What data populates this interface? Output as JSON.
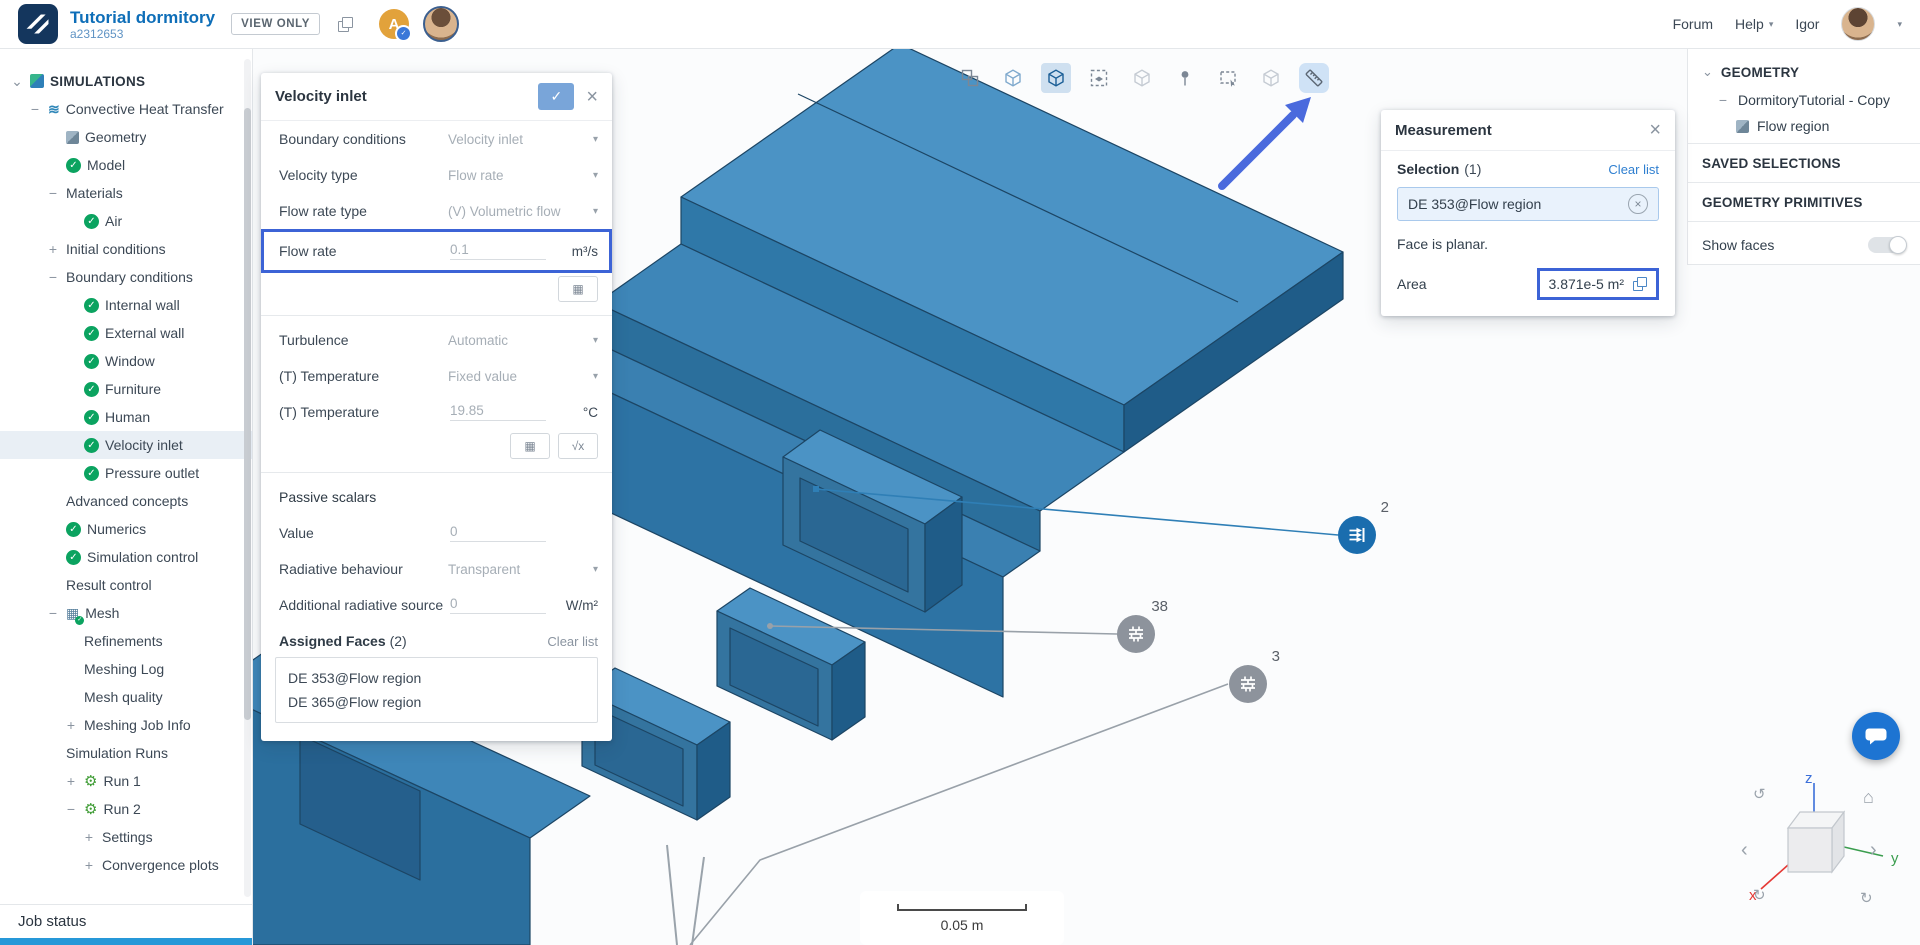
{
  "header": {
    "title": "Tutorial dormitory",
    "project_id": "a2312653",
    "view_only_badge": "VIEW ONLY",
    "owner_initial": "A",
    "nav": {
      "forum": "Forum",
      "help": "Help",
      "user": "Igor"
    }
  },
  "sidebar": {
    "items": [
      {
        "label": "SIMULATIONS",
        "indent": 0,
        "expander": "chevron",
        "icon": "simulations"
      },
      {
        "label": "Convective Heat Transfer",
        "indent": 1,
        "expander": "minus",
        "icon": "heat"
      },
      {
        "label": "Geometry",
        "indent": 2,
        "icon": "geometry"
      },
      {
        "label": "Model",
        "indent": 2,
        "icon": "check"
      },
      {
        "label": "Materials",
        "indent": 2,
        "expander": "minus"
      },
      {
        "label": "Air",
        "indent": 3,
        "icon": "check"
      },
      {
        "label": "Initial conditions",
        "indent": 2,
        "expander": "plus"
      },
      {
        "label": "Boundary conditions",
        "indent": 2,
        "expander": "minus"
      },
      {
        "label": "Internal wall",
        "indent": 3,
        "icon": "check"
      },
      {
        "label": "External wall",
        "indent": 3,
        "icon": "check"
      },
      {
        "label": "Window",
        "indent": 3,
        "icon": "check"
      },
      {
        "label": "Furniture",
        "indent": 3,
        "icon": "check"
      },
      {
        "label": "Human",
        "indent": 3,
        "icon": "check"
      },
      {
        "label": "Velocity inlet",
        "indent": 3,
        "icon": "check",
        "selected": true
      },
      {
        "label": "Pressure outlet",
        "indent": 3,
        "icon": "check"
      },
      {
        "label": "Advanced concepts",
        "indent": 2
      },
      {
        "label": "Numerics",
        "indent": 2,
        "icon": "check"
      },
      {
        "label": "Simulation control",
        "indent": 2,
        "icon": "check"
      },
      {
        "label": "Result control",
        "indent": 2
      },
      {
        "label": "Mesh",
        "indent": 2,
        "expander": "minus",
        "icon": "mesh"
      },
      {
        "label": "Refinements",
        "indent": 3
      },
      {
        "label": "Meshing Log",
        "indent": 3
      },
      {
        "label": "Mesh quality",
        "indent": 3
      },
      {
        "label": "Meshing Job Info",
        "indent": 3,
        "expander": "plus"
      },
      {
        "label": "Simulation Runs",
        "indent": 2
      },
      {
        "label": "Run 1",
        "indent": 3,
        "expander": "plus",
        "icon": "gear"
      },
      {
        "label": "Run 2",
        "indent": 3,
        "expander": "minus",
        "icon": "gear"
      },
      {
        "label": "Settings",
        "indent": 4,
        "expander": "plus"
      },
      {
        "label": "Convergence plots",
        "indent": 4,
        "expander": "plus"
      }
    ],
    "job_status": "Job status"
  },
  "inlet_panel": {
    "title": "Velocity inlet",
    "rows": [
      {
        "t": "select",
        "label": "Boundary conditions",
        "value": "Velocity inlet"
      },
      {
        "t": "select",
        "label": "Velocity type",
        "value": "Flow rate"
      },
      {
        "t": "select",
        "label": "Flow rate type",
        "value": "(V) Volumetric flow"
      },
      {
        "t": "input",
        "label": "Flow rate",
        "value": "0.1",
        "unit": "m³/s",
        "highlight": true
      },
      {
        "t": "buttons",
        "icons": [
          "table"
        ]
      },
      {
        "t": "divider"
      },
      {
        "t": "select",
        "label": "Turbulence",
        "value": "Automatic"
      },
      {
        "t": "select",
        "label": "(T) Temperature",
        "value": "Fixed value"
      },
      {
        "t": "input",
        "label": "(T) Temperature",
        "value": "19.85",
        "unit": "°C"
      },
      {
        "t": "buttons",
        "icons": [
          "table",
          "formula"
        ]
      },
      {
        "t": "divider"
      },
      {
        "t": "section",
        "label": "Passive scalars"
      },
      {
        "t": "input",
        "label": "Value",
        "value": "0",
        "unit": ""
      },
      {
        "t": "select",
        "label": "Radiative behaviour",
        "value": "Transparent"
      },
      {
        "t": "input",
        "label": "Additional radiative source",
        "value": "0",
        "unit": "W/m²"
      }
    ],
    "assigned": {
      "label": "Assigned Faces",
      "count": "(2)",
      "clear": "Clear list",
      "items": [
        "DE 353@Flow region",
        "DE 365@Flow region"
      ]
    }
  },
  "toolbar": {
    "icons": [
      {
        "name": "select-group-icon",
        "state": "normal",
        "glyph": "layers"
      },
      {
        "name": "view-solid-icon",
        "state": "tinted",
        "glyph": "cube"
      },
      {
        "name": "select-volume-icon",
        "state": "active",
        "glyph": "cube"
      },
      {
        "name": "select-face-icon",
        "state": "normal",
        "glyph": "face"
      },
      {
        "name": "select-edge-icon",
        "state": "disabled",
        "glyph": "cube"
      },
      {
        "name": "probe-point-icon",
        "state": "normal",
        "glyph": "pin"
      },
      {
        "name": "box-select-icon",
        "state": "normal",
        "glyph": "marquee"
      },
      {
        "name": "select-hidden-icon",
        "state": "disabled",
        "glyph": "cube"
      },
      {
        "name": "measure-tool-icon",
        "state": "highlight",
        "glyph": "measure"
      }
    ]
  },
  "measurement": {
    "title": "Measurement",
    "selection_label": "Selection",
    "selection_count": "(1)",
    "clear": "Clear list",
    "chip": "DE 353@Flow region",
    "note": "Face is planar.",
    "area_label": "Area",
    "area_value": "3.871e-5 m²"
  },
  "geometry_panel": {
    "geometry_header": "GEOMETRY",
    "tree_root": "DormitoryTutorial - Copy",
    "tree_child": "Flow region",
    "saved_selections": "SAVED SELECTIONS",
    "geometry_primitives": "GEOMETRY PRIMITIVES",
    "show_faces": "Show faces"
  },
  "viewport": {
    "markers": [
      {
        "label": "2",
        "type": "inlet"
      },
      {
        "label": "38",
        "type": "wall"
      },
      {
        "label": "3",
        "type": "wall"
      }
    ],
    "scale_label": "0.05 m"
  },
  "nav_cube": {
    "x": "x",
    "y": "y",
    "z": "z"
  },
  "colors": {
    "accent": "#3c63d6",
    "check_green": "#0ba360",
    "geometry_blue": "#2f78a8"
  }
}
